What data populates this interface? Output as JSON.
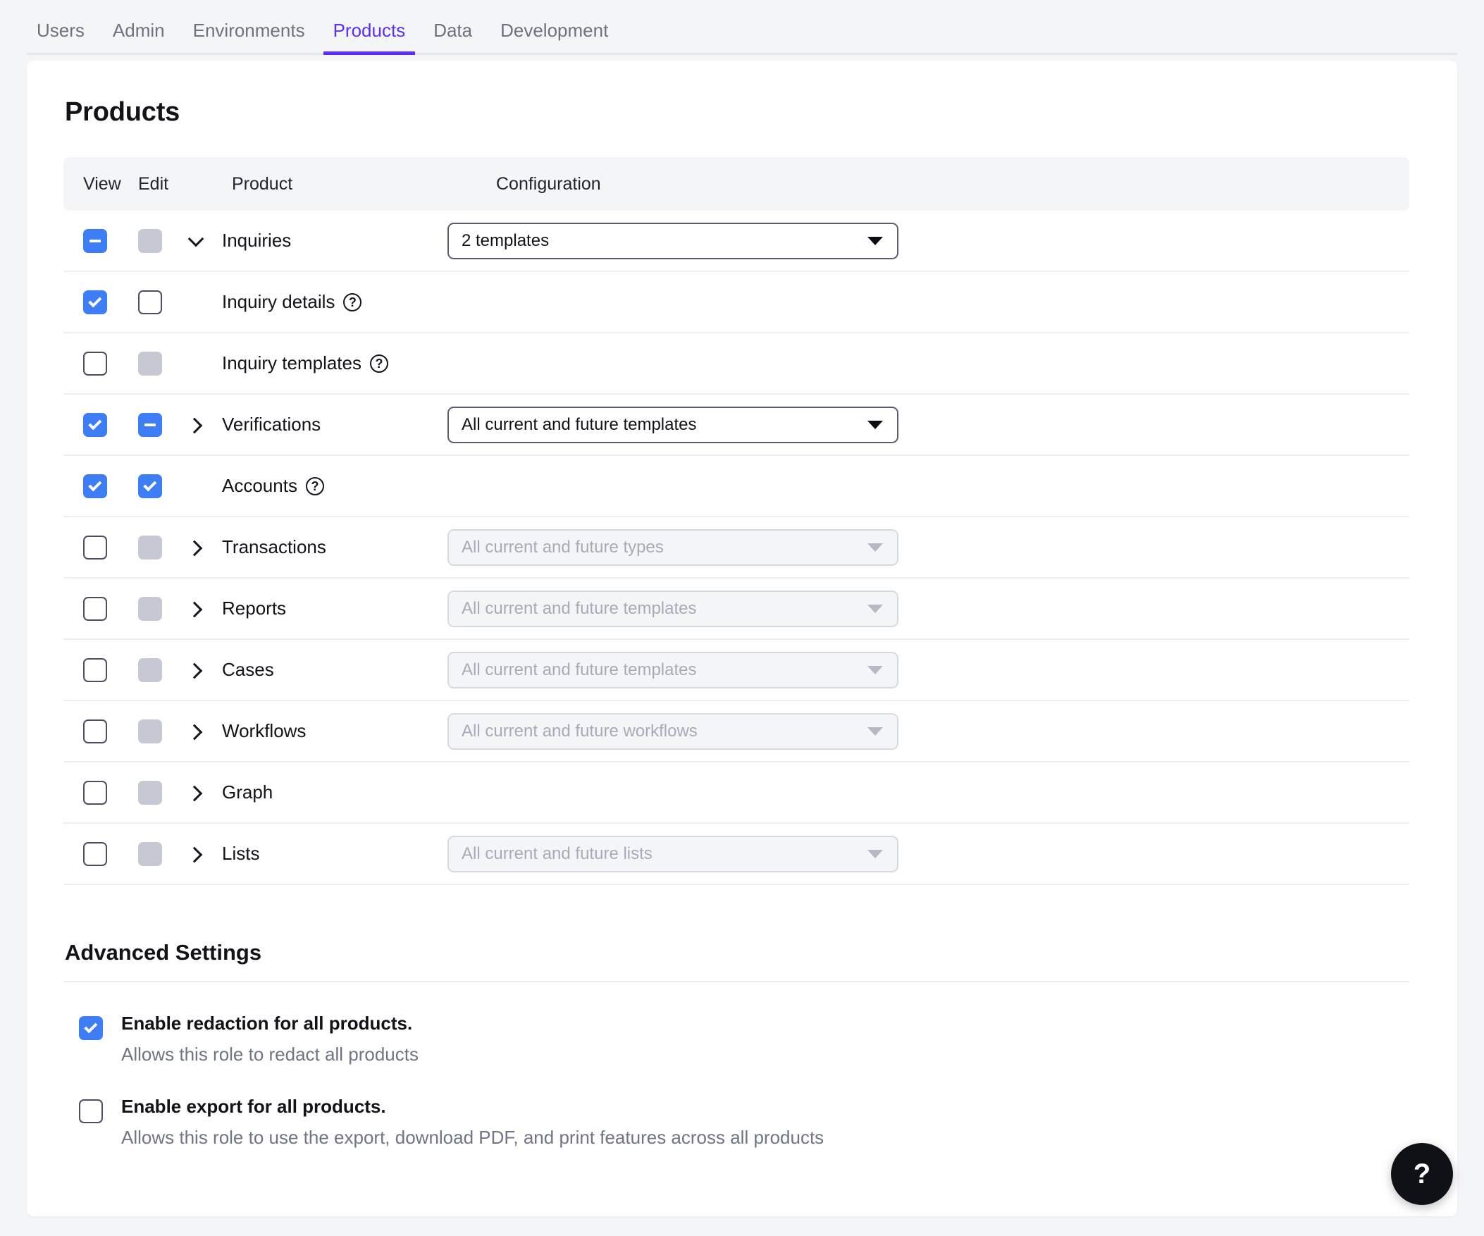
{
  "nav": {
    "tabs": [
      {
        "label": "Users",
        "active": false
      },
      {
        "label": "Admin",
        "active": false
      },
      {
        "label": "Environments",
        "active": false
      },
      {
        "label": "Products",
        "active": true
      },
      {
        "label": "Data",
        "active": false
      },
      {
        "label": "Development",
        "active": false
      }
    ],
    "accent_color": "#5b2ff5"
  },
  "page": {
    "title": "Products"
  },
  "table": {
    "headers": {
      "view": "View",
      "edit": "Edit",
      "product": "Product",
      "configuration": "Configuration"
    },
    "rows": [
      {
        "product": "Inquiries",
        "view": "indeterminate",
        "edit": "disabled",
        "chevron": "down",
        "help": false,
        "config": {
          "present": true,
          "value": "2 templates",
          "disabled": false
        }
      },
      {
        "product": "Inquiry details",
        "view": "checked",
        "edit": "unchecked",
        "chevron": "none",
        "help": true,
        "config": {
          "present": false,
          "value": "",
          "disabled": false
        }
      },
      {
        "product": "Inquiry templates",
        "view": "unchecked",
        "edit": "disabled",
        "chevron": "none",
        "help": true,
        "config": {
          "present": false,
          "value": "",
          "disabled": false
        }
      },
      {
        "product": "Verifications",
        "view": "checked",
        "edit": "indeterminate",
        "chevron": "right",
        "help": false,
        "config": {
          "present": true,
          "value": "All current and future templates",
          "disabled": false
        }
      },
      {
        "product": "Accounts",
        "view": "checked",
        "edit": "checked",
        "chevron": "none",
        "help": true,
        "config": {
          "present": false,
          "value": "",
          "disabled": false
        }
      },
      {
        "product": "Transactions",
        "view": "unchecked",
        "edit": "disabled",
        "chevron": "right",
        "help": false,
        "config": {
          "present": true,
          "value": "All current and future types",
          "disabled": true
        }
      },
      {
        "product": "Reports",
        "view": "unchecked",
        "edit": "disabled",
        "chevron": "right",
        "help": false,
        "config": {
          "present": true,
          "value": "All current and future templates",
          "disabled": true
        }
      },
      {
        "product": "Cases",
        "view": "unchecked",
        "edit": "disabled",
        "chevron": "right",
        "help": false,
        "config": {
          "present": true,
          "value": "All current and future templates",
          "disabled": true
        }
      },
      {
        "product": "Workflows",
        "view": "unchecked",
        "edit": "disabled",
        "chevron": "right",
        "help": false,
        "config": {
          "present": true,
          "value": "All current and future workflows",
          "disabled": true
        }
      },
      {
        "product": "Graph",
        "view": "unchecked",
        "edit": "disabled",
        "chevron": "right",
        "help": false,
        "config": {
          "present": false,
          "value": "",
          "disabled": false
        }
      },
      {
        "product": "Lists",
        "view": "unchecked",
        "edit": "disabled",
        "chevron": "right",
        "help": false,
        "config": {
          "present": true,
          "value": "All current and future lists",
          "disabled": true
        }
      }
    ]
  },
  "advanced": {
    "title": "Advanced Settings",
    "items": [
      {
        "state": "checked",
        "label": "Enable redaction for all products.",
        "description": "Allows this role to redact all products"
      },
      {
        "state": "unchecked",
        "label": "Enable export for all products.",
        "description": "Allows this role to use the export, download PDF, and print features across all products"
      }
    ]
  },
  "fab": {
    "label": "?",
    "icon": "question-mark-icon",
    "background": "#0e1116"
  },
  "colors": {
    "checkbox_checked": "#3d7df6",
    "checkbox_disabled": "#c6c9d4",
    "accent": "#5b2ff5",
    "header_bg": "#f4f5f7"
  }
}
